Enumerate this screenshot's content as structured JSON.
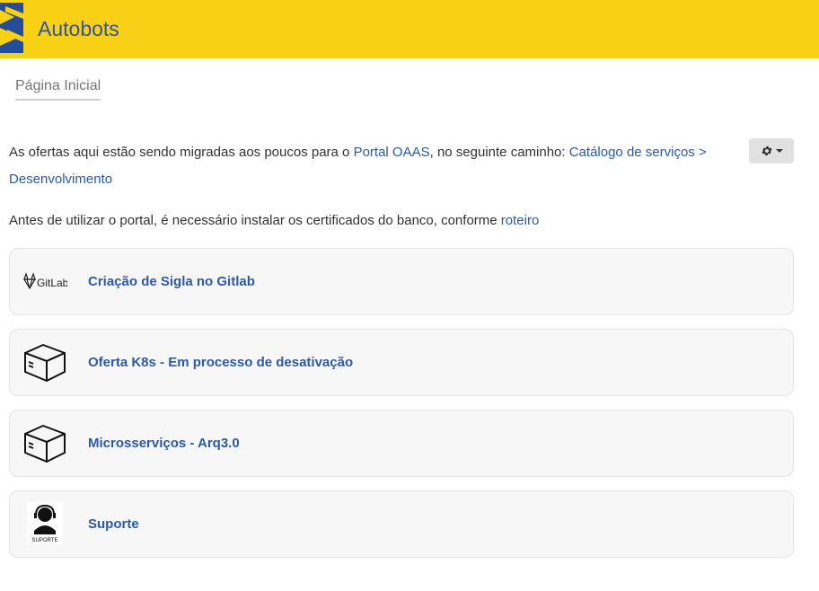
{
  "app": {
    "title": "Autobots"
  },
  "breadcrumb": {
    "current": "Página Inicial"
  },
  "intro": {
    "text_before": "As ofertas aqui estão sendo migradas aos poucos para o ",
    "portal_link": "Portal OAAS",
    "text_middle": ", no seguinte caminho: ",
    "path_link": "Catálogo de serviços > Desenvolvimento"
  },
  "notice": {
    "text": "Antes de utilizar o portal, é necessário instalar os certificados do banco, conforme ",
    "link": "roteiro"
  },
  "settings": {
    "icon": "gear-icon"
  },
  "offers": [
    {
      "title": "Criação de Sigla no Gitlab",
      "icon": "gitlab-logo-icon",
      "icon_text": "GitLab"
    },
    {
      "title": "Oferta K8s - Em processo de desativação",
      "icon": "box-icon"
    },
    {
      "title": "Microsserviços - Arq3.0",
      "icon": "box-icon"
    },
    {
      "title": "Suporte",
      "icon": "support-agent-icon",
      "icon_text": "SUPORTE"
    }
  ],
  "colors": {
    "topbar": "#f8d117",
    "title": "#31548f",
    "link": "#2b5aa6",
    "logo_blue": "#234d9b"
  }
}
